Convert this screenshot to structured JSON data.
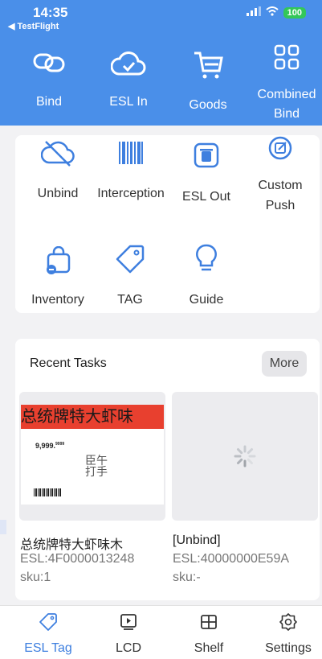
{
  "status": {
    "time": "14:35",
    "back_app": "◀ TestFlight",
    "battery": "100"
  },
  "header": {
    "items": [
      {
        "label": "Bind",
        "icon": "link-icon"
      },
      {
        "label": "ESL In",
        "icon": "cloud-check-icon"
      },
      {
        "label": "Goods",
        "icon": "cart-icon"
      },
      {
        "label": "Combined Bind",
        "icon": "grid-icon"
      }
    ]
  },
  "grid": {
    "items": [
      {
        "label": "Unbind",
        "icon": "cloud-off-icon"
      },
      {
        "label": "Interception",
        "icon": "barcode-icon"
      },
      {
        "label": "ESL Out",
        "icon": "trash-icon"
      },
      {
        "label": "Custom Push",
        "icon": "edit-circle-icon"
      },
      {
        "label": "Inventory",
        "icon": "bag-icon"
      },
      {
        "label": "TAG",
        "icon": "tag-icon"
      },
      {
        "label": "Guide",
        "icon": "bulb-icon"
      }
    ]
  },
  "recent": {
    "title": "Recent Tasks",
    "more": "More",
    "tasks": [
      {
        "name": "总统牌特大虾味木",
        "esl": "ESL:4F0000013248",
        "sku": "sku:1",
        "label_banner": "总统牌特大虾味",
        "label_price": "9,999.",
        "label_price_small": "9999",
        "label_code": "臣午\n打手"
      },
      {
        "name": "[Unbind]",
        "esl": "ESL:40000000E59A",
        "sku": "sku:-"
      }
    ]
  },
  "tabs": [
    {
      "label": "ESL Tag",
      "icon": "tag-icon",
      "active": true
    },
    {
      "label": "LCD",
      "icon": "play-screen-icon"
    },
    {
      "label": "Shelf",
      "icon": "shelf-grid-icon"
    },
    {
      "label": "Settings",
      "icon": "gear-icon"
    }
  ],
  "colors": {
    "accent": "#4a8fe9",
    "active_tab": "#3e7fdf",
    "banner": "#e8402f"
  }
}
